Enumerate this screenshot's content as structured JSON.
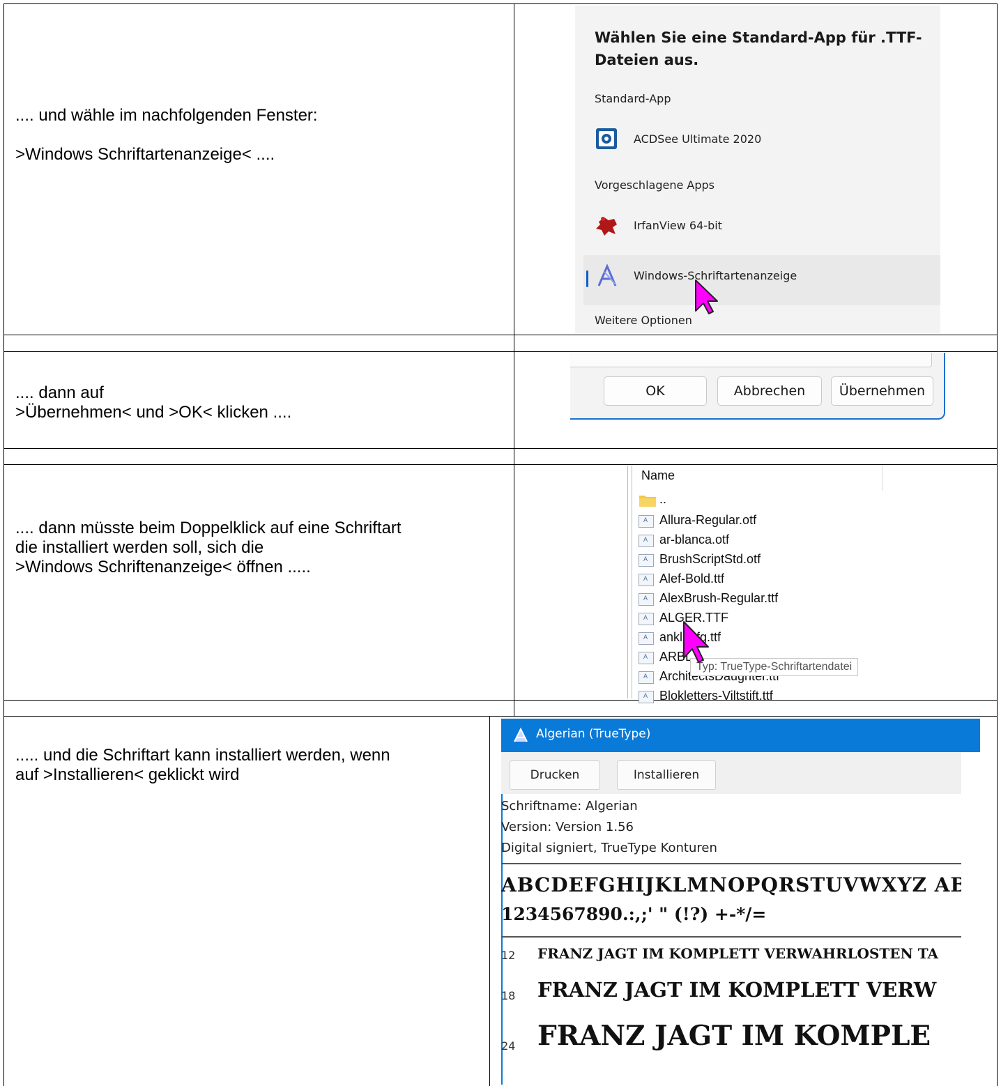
{
  "rows": [
    {
      "instruction": ".... und wähle im nachfolgenden Fenster:\n\n>Windows Schriftartenanzeige< ...."
    },
    {
      "instruction": ".... dann auf\n>Übernehmen< und >OK< klicken ...."
    },
    {
      "instruction": ".... dann müsste beim Doppelklick auf eine Schriftart\ndie installiert werden soll, sich die\n>Windows Schriftenanzeige< öffnen ....."
    },
    {
      "instruction": "..... und die Schriftart kann installiert werden, wenn\nauf >Installieren< geklickt wird"
    }
  ],
  "app_chooser": {
    "title": "Wählen Sie eine Standard-App für .TTF-\nDateien aus.",
    "section_default": "Standard-App",
    "default_app": "ACDSee Ultimate 2020",
    "section_suggested": "Vorgeschlagene Apps",
    "suggested_apps": [
      "IrfanView 64-bit",
      "Windows-Schriftartenanzeige"
    ],
    "more_options": "Weitere Optionen",
    "accent_color": "#0a5fc7",
    "cursor_color": "#ff00ff"
  },
  "dialog_buttons": {
    "ok": "OK",
    "cancel": "Abbrechen",
    "apply": "Übernehmen"
  },
  "file_list": {
    "column_header": "Name",
    "parent_folder": "..",
    "files": [
      "Allura-Regular.otf",
      "ar-blanca.otf",
      "BrushScriptStd.otf",
      "Alef-Bold.ttf",
      "AlexBrush-Regular.ttf",
      "ALGER.TTF",
      "anklig-fg.ttf",
      "ARBL",
      "ArchitectsDaughter.ttf",
      "Blokletters-Viltstift.ttf"
    ],
    "tooltip": "Typ: TrueType-Schriftartendatei"
  },
  "font_viewer": {
    "title": "Algerian (TrueType)",
    "print_button": "Drucken",
    "install_button": "Installieren",
    "font_name": "Schriftname: Algerian",
    "version": "Version: Version 1.56",
    "signature": "Digital signiert, TrueType Konturen",
    "alphabet": "ABCDEFGHIJKLMNOPQRSTUVWXYZ ABC",
    "digits": "1234567890.:,;' \" (!?) +-*/=",
    "sizes": [
      "12",
      "18",
      "24"
    ],
    "pangram_12": "FRANZ JAGT IM KOMPLETT VERWAHRLOSTEN TA",
    "pangram_18": "FRANZ JAGT IM KOMPLETT VERW",
    "pangram_24": "FRANZ JAGT IM KOMPLE",
    "titlebar_color": "#0a7ad9"
  }
}
